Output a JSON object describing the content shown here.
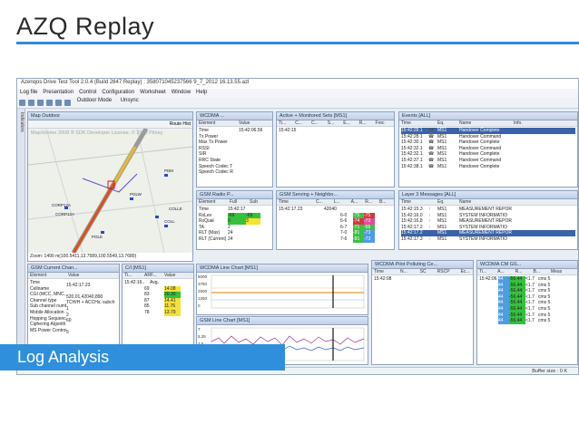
{
  "slide": {
    "title": "AZQ Replay",
    "label": "Log Analysis"
  },
  "app": {
    "window_title": "Azenqos Drive Test Tool 2.0.4 (Build 2847 Replay) : 358071045237566 9_7_2012 16.13.55.azl",
    "menu": [
      "Log file",
      "Presentation",
      "Control",
      "Configuration",
      "Worksheet",
      "Window",
      "Help"
    ],
    "toolbar": {
      "outdoor": "Outdoor Mode",
      "unsync": "Unsync"
    },
    "side_tab": "Indicators",
    "buffer": "Buffer size : 0 K"
  },
  "map": {
    "title": "Map Outdoor",
    "route_btn": "Route Hist",
    "watermark": "MapXtreme 2008 ® SDK Developer License, © 2009 Pitney",
    "zoom": "Zoom: 1490 m(100.5411,13.7589,100.5549,13.7680)",
    "cells": [
      "CORP12A",
      "CORP12A",
      "COLLE",
      "COLL",
      "POLW",
      "PDM",
      "POLE"
    ]
  },
  "wcdma_panel": {
    "title": "WCDMA ...",
    "headers": [
      "Element",
      "Value"
    ],
    "rows": [
      [
        "Time",
        "15:42:06.56"
      ],
      [
        "Tx Power",
        ""
      ],
      [
        "Max Tx Power",
        ""
      ],
      [
        "RSSI",
        ""
      ],
      [
        "SIR",
        ""
      ],
      [
        "RRC State",
        ""
      ],
      [
        "Speech Codec T",
        ""
      ],
      [
        "Speech Codec R",
        ""
      ]
    ]
  },
  "active_sets": {
    "title": "Active + Monitored Sets [MS1]",
    "headers": [
      "Ti...",
      "C...",
      "C...",
      "S...",
      "E...",
      "R...",
      "Frec"
    ],
    "time": "15:42:15"
  },
  "events": {
    "title": "Events [ALL]",
    "headers": [
      "Time",
      "Eq.",
      "Name",
      "Info."
    ],
    "rows": [
      [
        "15:42:28.1",
        "MS1",
        "Handover Complete"
      ],
      [
        "15:42:28.1",
        "MS1",
        "Handover Command"
      ],
      [
        "15:42:30.1",
        "MS1",
        "Handover Complete"
      ],
      [
        "15:42:32.1",
        "MS1",
        "Handover Command"
      ],
      [
        "15:42:32.1",
        "MS1",
        "Handover Complete"
      ],
      [
        "15:42:37.1",
        "MS1",
        "Handover Command"
      ],
      [
        "15:42:38.1",
        "MS1",
        "Handover Complete"
      ]
    ]
  },
  "gsm_radio": {
    "title": "GSM Radio P...",
    "headers": [
      "Element",
      "Full",
      "Sub"
    ],
    "rows": [
      [
        "Time",
        "15:42:17",
        ""
      ],
      [
        "RxLev",
        "-69",
        "-69"
      ],
      [
        "RxQual",
        "0",
        "3"
      ],
      [
        "TA",
        "2",
        ""
      ],
      [
        "RLT (Max)",
        "24",
        ""
      ],
      [
        "RLT (Current)",
        "24",
        ""
      ]
    ]
  },
  "gsm_serving": {
    "title": "GSM Serving + Neighbo...",
    "headers": [
      "Time",
      "C...",
      "L...",
      "A...",
      "R...",
      "B..."
    ],
    "time": "15:42:17.23",
    "lac": "42040",
    "rows": [
      [
        "6-0",
        "-75",
        "-75"
      ],
      [
        "6-6",
        "-74",
        "-73"
      ],
      [
        "6-7",
        "-71",
        "-56"
      ],
      [
        "7-0",
        "-81",
        "-73"
      ],
      [
        "7-6",
        "-81",
        "-73"
      ]
    ]
  },
  "layer3": {
    "title": "Layer 3 Messages [ALL]",
    "headers": [
      "Time",
      "Eq.",
      "Name"
    ],
    "rows": [
      [
        "15:42:15.3",
        "MS1",
        "MEASUREMENT REPOR"
      ],
      [
        "15:42:16.0",
        "MS1",
        "SYSTEM INFORMATIO"
      ],
      [
        "15:42:16.8",
        "MS1",
        "MEASUREMENT REPOR"
      ],
      [
        "15:42:17.2",
        "MS1",
        "SYSTEM INFORMATIO"
      ],
      [
        "15:42:17.2",
        "MS1",
        "MEASUREMENT REPOR"
      ],
      [
        "15:42:17.3",
        "MS1",
        "SYSTEM INFORMATIO"
      ]
    ]
  },
  "gsm_current": {
    "title": "GSM Current Chan...",
    "headers": [
      "Element",
      "Value"
    ],
    "rows": [
      [
        "Time",
        "15:42:17.23"
      ],
      [
        "Cellname",
        ""
      ],
      [
        "CGI (MCC, MNC,",
        "520,01,42040,890"
      ],
      [
        "Channel type",
        "TCH/H + ACCHs, subch"
      ],
      [
        "Sub channel numb",
        "1"
      ],
      [
        "Mobile Allocation",
        "2"
      ],
      [
        "Hopping Sequenc",
        "60"
      ],
      [
        "Ciphering Algorith",
        ""
      ],
      [
        "MS Power Control",
        "5"
      ]
    ]
  },
  "ci": {
    "title": "C/I [MS1]",
    "headers": [
      "Ti...",
      "ARF...",
      "Value"
    ],
    "time": "15:42:16..",
    "avg": "Avg.",
    "rows": [
      [
        "69",
        "14.08"
      ],
      [
        "83",
        "20.30"
      ],
      [
        "87",
        "14.41"
      ],
      [
        "85",
        "11.76"
      ],
      [
        "78",
        "13.79"
      ]
    ]
  },
  "wcdma_chart1": {
    "title": "WCDMA Line Chart [MS1]",
    "yticks": [
      "5000",
      "3750",
      "2500",
      "1250",
      "0"
    ]
  },
  "gsm_chart": {
    "title": "GSM Line Chart [MS1]",
    "yticks": [
      "7",
      "5.25",
      "3.5",
      "1.75",
      "0"
    ]
  },
  "pilot": {
    "title": "WCDMA Pilot Polluting Ce...",
    "headers": [
      "Time",
      "N...",
      "SC",
      "RSCP",
      "Ec..."
    ],
    "time": "15:42:08"
  },
  "cm": {
    "title": "WCDMA CM GS...",
    "headers": [
      "Ti...",
      "A...",
      "R...",
      "B...",
      "Meas"
    ],
    "time": "15:42:06",
    "rows": [
      [
        "44",
        "-56.44",
        "<1.7",
        "cms 5"
      ],
      [
        "44",
        "-56.44",
        "<1.7",
        "cms 5"
      ],
      [
        "44",
        "-56.44",
        "<1.7",
        "cms 5"
      ],
      [
        "44",
        "-56.44",
        "<1.7",
        "cms 5"
      ],
      [
        "44",
        "-56.44",
        "<1.7",
        "cms 5"
      ],
      [
        "44",
        "-56.44",
        "<1.7",
        "cms 5"
      ],
      [
        "44",
        "-56.44",
        "<1.7",
        "cms 5"
      ],
      [
        "44",
        "-56.44",
        "<1.7",
        "cms 5"
      ]
    ]
  }
}
